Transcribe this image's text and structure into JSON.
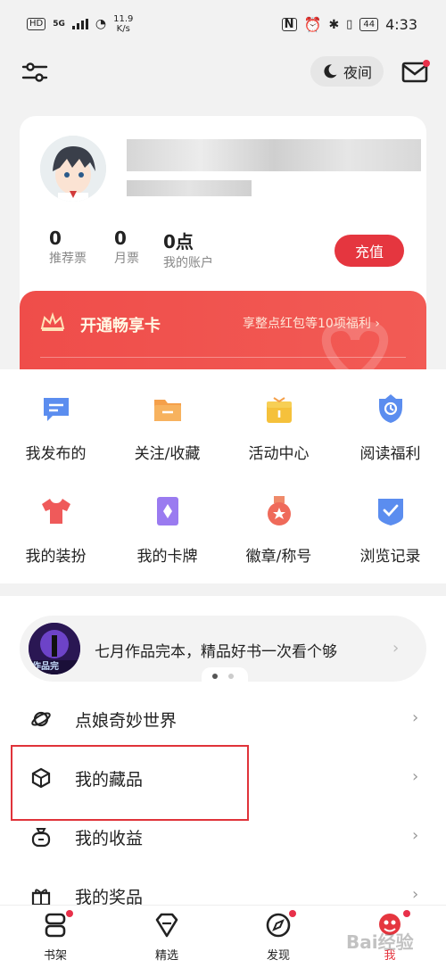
{
  "status_bar": {
    "hd": "HD",
    "signal": "5G",
    "speed_value": "11.9",
    "speed_unit": "K/s",
    "battery": "44",
    "time": "4:33"
  },
  "header": {
    "night_label": "夜间"
  },
  "profile": {
    "stats": [
      {
        "value": "0",
        "label": "推荐票"
      },
      {
        "value": "0",
        "label": "月票"
      },
      {
        "value": "0点",
        "label": "我的账户"
      }
    ],
    "recharge_label": "充值",
    "vip_title": "开通畅享卡",
    "vip_subtitle": "享整点红包等10项福利"
  },
  "grid": [
    {
      "label": "我发布的",
      "icon": "chat-icon",
      "color": "#5b8def"
    },
    {
      "label": "关注/收藏",
      "icon": "folder-icon",
      "color": "#f5a04a"
    },
    {
      "label": "活动中心",
      "icon": "gift-icon",
      "color": "#f5c13b"
    },
    {
      "label": "阅读福利",
      "icon": "clock-badge-icon",
      "color": "#5b8def"
    },
    {
      "label": "我的装扮",
      "icon": "shirt-icon",
      "color": "#ef5a5a"
    },
    {
      "label": "我的卡牌",
      "icon": "card-icon",
      "color": "#9a7bf0"
    },
    {
      "label": "徽章/称号",
      "icon": "medal-icon",
      "color": "#ef6a5a"
    },
    {
      "label": "浏览记录",
      "icon": "shield-check-icon",
      "color": "#5b8def"
    }
  ],
  "promo": {
    "text": "七月作品完本，精品好书一次看个够",
    "image_text": "作品完"
  },
  "list": [
    {
      "label": "点娘奇妙世界",
      "icon": "planet-icon"
    },
    {
      "label": "我的藏品",
      "icon": "cube-icon"
    },
    {
      "label": "我的收益",
      "icon": "money-bag-icon"
    },
    {
      "label": "我的奖品",
      "icon": "gift-icon"
    }
  ],
  "nav": [
    {
      "label": "书架",
      "icon": "bookshelf-icon"
    },
    {
      "label": "精选",
      "icon": "diamond-icon"
    },
    {
      "label": "发现",
      "icon": "compass-icon"
    },
    {
      "label": "我",
      "icon": "profile-icon"
    }
  ],
  "watermark": "Bai经验",
  "colors": {
    "accent": "#e5363f",
    "banner": "#ef4d4a",
    "highlight": "#e0333a",
    "dot": "#e8304a"
  }
}
